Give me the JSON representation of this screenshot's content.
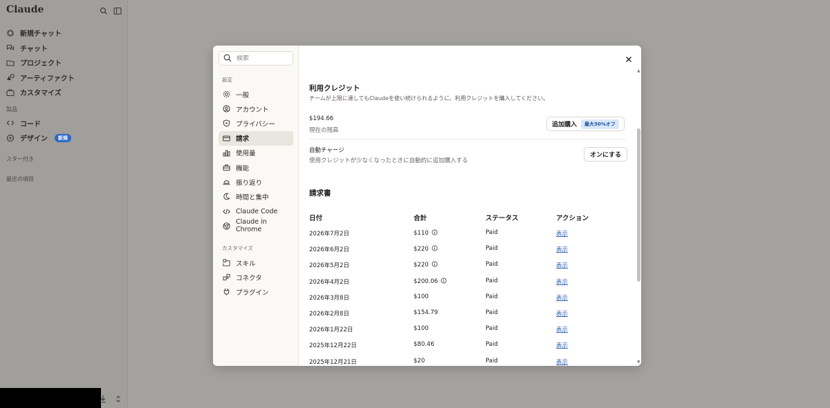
{
  "app": {
    "logo": "Claude",
    "nav": [
      {
        "label": "新規チャット",
        "icon": "plus-circle-icon"
      },
      {
        "label": "チャット",
        "icon": "chat-bubbles-icon"
      },
      {
        "label": "プロジェクト",
        "icon": "folder-icon"
      },
      {
        "label": "アーティファクト",
        "icon": "artifacts-icon"
      },
      {
        "label": "カスタマイズ",
        "icon": "briefcase-icon"
      }
    ],
    "section_products": "製品",
    "products": [
      {
        "label": "コード",
        "icon": "code-icon"
      },
      {
        "label": "デザイン",
        "icon": "design-icon",
        "badge": "新規"
      }
    ],
    "section_starred": "スター付き",
    "section_recent": "最近の項目"
  },
  "modal": {
    "search_placeholder": "検索",
    "settings_label": "設定",
    "settings_items": [
      {
        "label": "一般",
        "icon": "gear-icon",
        "active": false
      },
      {
        "label": "アカウント",
        "icon": "user-circle-icon",
        "active": false
      },
      {
        "label": "プライバシー",
        "icon": "shield-icon",
        "active": false
      },
      {
        "label": "請求",
        "icon": "credit-card-icon",
        "active": true
      },
      {
        "label": "使用量",
        "icon": "bar-chart-icon",
        "active": false
      },
      {
        "label": "機能",
        "icon": "toolbox-icon",
        "active": false
      },
      {
        "label": "振り返り",
        "icon": "sunset-icon",
        "active": false
      },
      {
        "label": "時間と集中",
        "icon": "moon-icon",
        "active": false
      },
      {
        "label": "Claude Code",
        "icon": "code-brackets-icon",
        "active": false
      },
      {
        "label": "Claude in Chrome",
        "icon": "globe-icon",
        "active": false
      }
    ],
    "customize_label": "カスタマイズ",
    "customize_items": [
      {
        "label": "スキル",
        "icon": "skill-icon"
      },
      {
        "label": "コネクタ",
        "icon": "connector-icon"
      },
      {
        "label": "プラグイン",
        "icon": "plug-icon"
      }
    ],
    "credits": {
      "title": "利用クレジット",
      "description": "チームが上限に達してもClaudeを使い続けられるように、利用クレジットを購入してください。",
      "balance": "$194.66",
      "balance_label": "現在の残高",
      "buy_button": "追加購入",
      "discount": "最大30%オフ",
      "auto_charge_title": "自動チャージ",
      "auto_charge_desc": "使用クレジットが少なくなったときに自動的に追加購入する",
      "auto_charge_button": "オンにする"
    },
    "invoices": {
      "title": "請求書",
      "columns": [
        "日付",
        "合計",
        "ステータス",
        "アクション"
      ],
      "rows": [
        {
          "date": "2026年7月2日",
          "total": "$110",
          "info": true,
          "status": "Paid",
          "action": "表示"
        },
        {
          "date": "2026年6月2日",
          "total": "$220",
          "info": true,
          "status": "Paid",
          "action": "表示"
        },
        {
          "date": "2026年5月2日",
          "total": "$220",
          "info": true,
          "status": "Paid",
          "action": "表示"
        },
        {
          "date": "2026年4月2日",
          "total": "$200.06",
          "info": true,
          "status": "Paid",
          "action": "表示"
        },
        {
          "date": "2026年3月8日",
          "total": "$100",
          "info": false,
          "status": "Paid",
          "action": "表示"
        },
        {
          "date": "2026年2月8日",
          "total": "$154.79",
          "info": false,
          "status": "Paid",
          "action": "表示"
        },
        {
          "date": "2026年1月22日",
          "total": "$100",
          "info": false,
          "status": "Paid",
          "action": "表示"
        },
        {
          "date": "2025年12月22日",
          "total": "$80.46",
          "info": false,
          "status": "Paid",
          "action": "表示"
        },
        {
          "date": "2025年12月21日",
          "total": "$20",
          "info": false,
          "status": "Paid",
          "action": "表示"
        }
      ]
    }
  },
  "colors": {
    "overlay": "#8a8a87",
    "active_item": "#e8e6df",
    "link": "#2b5fb8",
    "discount_bg": "#dbe8fb"
  }
}
